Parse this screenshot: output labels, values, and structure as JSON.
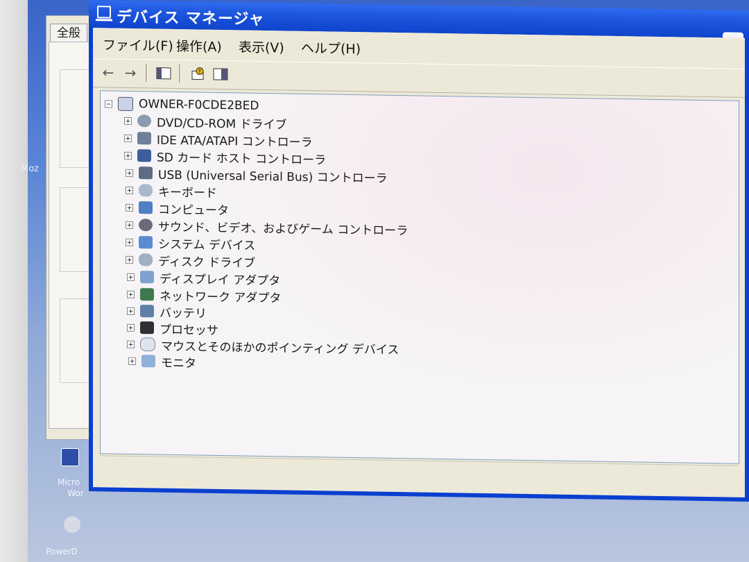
{
  "window": {
    "title": "デバイス マネージャ"
  },
  "menu": [
    {
      "label": "ファイル(F)"
    },
    {
      "label": "操作(A)"
    },
    {
      "label": "表示(V)"
    },
    {
      "label": "ヘルプ(H)"
    }
  ],
  "toolbar": {
    "back_icon": "arrow-left-icon",
    "forward_icon": "arrow-right-icon",
    "show_hide_icon": "console-tree-icon",
    "properties_icon": "help-properties-icon",
    "view_icon": "view-icon"
  },
  "tree": {
    "root": "OWNER-F0CDE2BED",
    "children": [
      {
        "label": "DVD/CD-ROM ドライブ",
        "icon": "cd-drive-icon"
      },
      {
        "label": "IDE ATA/ATAPI コントローラ",
        "icon": "ide-controller-icon"
      },
      {
        "label": "SD カード ホスト コントローラ",
        "icon": "sd-card-icon"
      },
      {
        "label": "USB (Universal Serial Bus) コントローラ",
        "icon": "usb-icon"
      },
      {
        "label": "キーボード",
        "icon": "keyboard-icon"
      },
      {
        "label": "コンピュータ",
        "icon": "computer-icon"
      },
      {
        "label": "サウンド、ビデオ、およびゲーム コントローラ",
        "icon": "sound-icon"
      },
      {
        "label": "システム デバイス",
        "icon": "system-device-icon"
      },
      {
        "label": "ディスク ドライブ",
        "icon": "disk-drive-icon"
      },
      {
        "label": "ディスプレイ アダプタ",
        "icon": "display-adapter-icon"
      },
      {
        "label": "ネットワーク アダプタ",
        "icon": "network-adapter-icon"
      },
      {
        "label": "バッテリ",
        "icon": "battery-icon"
      },
      {
        "label": "プロセッサ",
        "icon": "processor-icon"
      },
      {
        "label": "マウスとそのほかのポインティング デバイス",
        "icon": "mouse-icon"
      },
      {
        "label": "モニタ",
        "icon": "monitor-icon"
      }
    ]
  },
  "background_dialog": {
    "tab": "全般"
  },
  "desktop": {
    "labels": [
      "Moz",
      "Micro",
      "Wor",
      "PowerD"
    ]
  },
  "colors": {
    "titlebar": "#1e56dd",
    "window_frame": "#0a3fd0",
    "client": "#ece9d8",
    "tree_bg": "#f6f4f6"
  }
}
